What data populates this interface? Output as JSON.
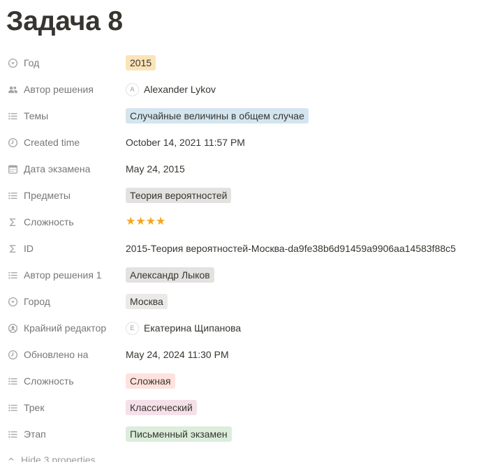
{
  "page": {
    "title": "Задача 8"
  },
  "properties": [
    {
      "name": "Год",
      "icon": "select-icon",
      "type": "tag",
      "value": "2015",
      "color": "#fbe4b8"
    },
    {
      "name": "Автор решения",
      "icon": "people-icon",
      "type": "person",
      "initial": "A",
      "value": "Alexander Lykov"
    },
    {
      "name": "Темы",
      "icon": "list-icon",
      "type": "tag",
      "value": "Случайные величины в общем случае",
      "color": "#d3e5ef"
    },
    {
      "name": "Created time",
      "icon": "clock-icon",
      "type": "text",
      "value": "October 14, 2021 11:57 PM"
    },
    {
      "name": "Дата экзамена",
      "icon": "calendar-icon",
      "type": "text",
      "value": "May 24, 2015"
    },
    {
      "name": "Предметы",
      "icon": "list-icon",
      "type": "tag",
      "value": "Теория вероятностей",
      "color": "#e3e2e0"
    },
    {
      "name": "Сложность",
      "icon": "formula-icon",
      "type": "stars",
      "value": "★★★★",
      "rating": 4
    },
    {
      "name": "ID",
      "icon": "formula-icon",
      "type": "text",
      "value": "2015-Теория вероятностей-Москва-da9fe38b6d91459a9906aa14583f88c5"
    },
    {
      "name": "Автор решения 1",
      "icon": "list-icon",
      "type": "tag",
      "value": "Александр Лыков",
      "color": "#e3e2e0"
    },
    {
      "name": "Город",
      "icon": "select-icon",
      "type": "tag",
      "value": "Москва",
      "color": "#ebeae8"
    },
    {
      "name": "Крайний редактор",
      "icon": "person-circle-icon",
      "type": "person",
      "initial": "E",
      "value": "Екатерина Щипанова"
    },
    {
      "name": "Обновлено на",
      "icon": "clock-icon",
      "type": "text",
      "value": "May 24, 2024 11:30 PM"
    },
    {
      "name": "Сложность",
      "icon": "list-icon",
      "type": "tag",
      "value": "Сложная",
      "color": "#ffe2dd"
    },
    {
      "name": "Трек",
      "icon": "list-icon",
      "type": "tag",
      "value": "Классический",
      "color": "#f5e0e9"
    },
    {
      "name": "Этап",
      "icon": "list-icon",
      "type": "tag",
      "value": "Письменный экзамен",
      "color": "#dbeddb"
    }
  ],
  "footer": {
    "hide_label": "Hide 3 properties"
  }
}
